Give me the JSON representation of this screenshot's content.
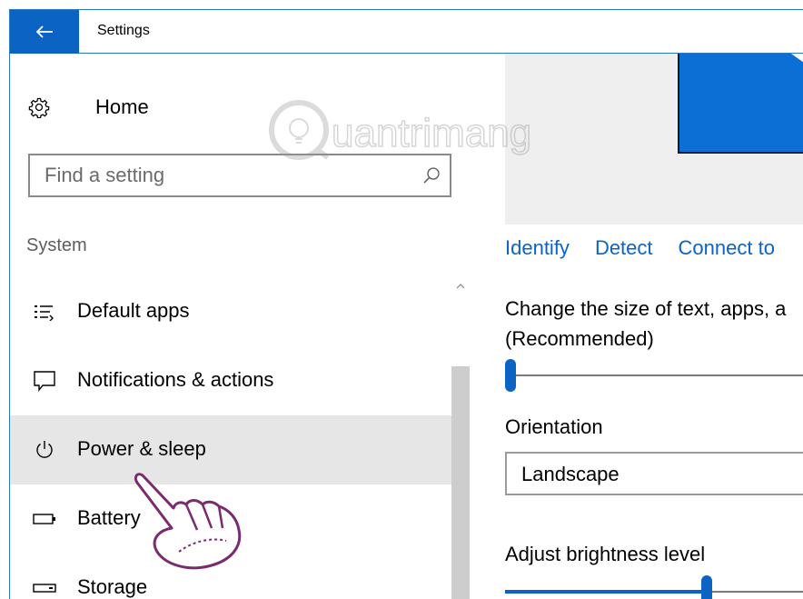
{
  "window": {
    "title": "Settings",
    "back_icon": "back-arrow-icon"
  },
  "sidebar": {
    "home_label": "Home",
    "home_icon": "gear-icon",
    "search_placeholder": "Find a setting",
    "search_icon": "search-icon",
    "section_label": "System",
    "items": [
      {
        "label": "Default apps",
        "icon": "default-apps-icon",
        "selected": false
      },
      {
        "label": "Notifications & actions",
        "icon": "notification-icon",
        "selected": false
      },
      {
        "label": "Power & sleep",
        "icon": "power-icon",
        "selected": true
      },
      {
        "label": "Battery",
        "icon": "battery-icon",
        "selected": false
      },
      {
        "label": "Storage",
        "icon": "storage-icon",
        "selected": false
      }
    ]
  },
  "display": {
    "links": [
      "Identify",
      "Detect",
      "Connect to"
    ],
    "scale_text_line1": "Change the size of text, apps, a",
    "scale_text_line2": "(Recommended)",
    "scale_value": 0,
    "orientation_label": "Orientation",
    "orientation_value": "Landscape",
    "brightness_label": "Adjust brightness level",
    "brightness_value": 0.68
  },
  "watermark": {
    "text": "uantrimang"
  },
  "colors": {
    "accent": "#0b63c4",
    "selected_bg": "#e6e6e6",
    "monitor": "#0b6fd6"
  }
}
